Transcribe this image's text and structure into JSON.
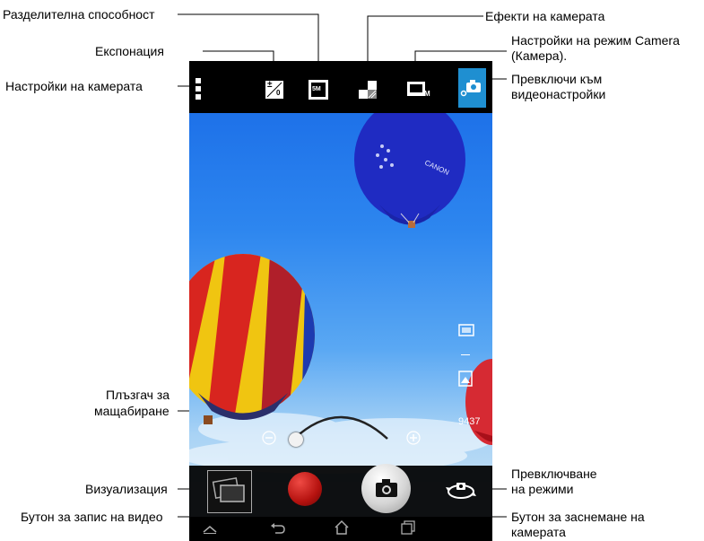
{
  "callouts": {
    "resolution": "Разделителна способност",
    "exposure": "Експонация",
    "camera_settings": "Настройки на камерата",
    "camera_effects": "Ефекти на камерата",
    "camera_mode_settings_line1": "Настройки на режим Camera",
    "camera_mode_settings_line2": "(Камера).",
    "switch_video_line1": "Превключи към",
    "switch_video_line2": "видеонастройки",
    "zoom_slider_line1": "Плъзгач за",
    "zoom_slider_line2": "мащабиране",
    "preview": "Визуализация",
    "video_record": "Бутон за запис на видео",
    "switch_modes_line1": "Превключване",
    "switch_modes_line2": "на режими",
    "shutter_line1": "Бутон за заснемане на",
    "shutter_line2": "камерата"
  },
  "toolbar": {
    "exposure_badge": "±",
    "exposure_value": "0",
    "resolution_badge": "5M",
    "camera_mode_badge": "M"
  },
  "viewfinder": {
    "remaining_shots": "9437",
    "balloon_text": "CANON"
  },
  "colors": {
    "sky_top": "#1768e6",
    "topbar": "#000000",
    "video_switch_accent": "#1f8fd1",
    "record_button": "#b5120f"
  }
}
